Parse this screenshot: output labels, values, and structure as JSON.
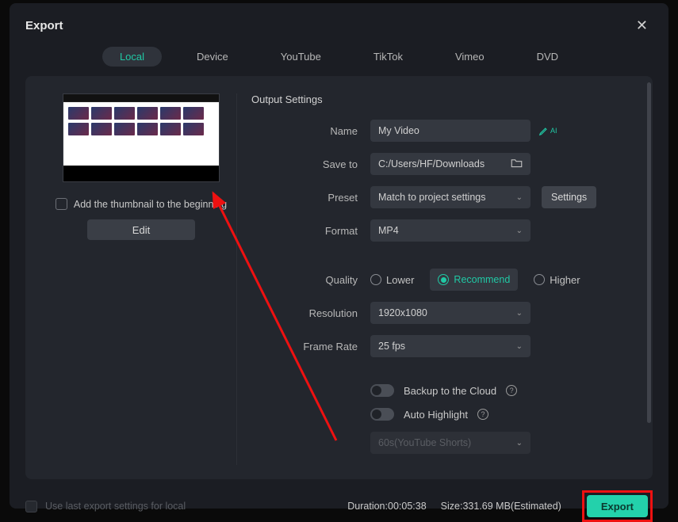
{
  "title": "Export",
  "tabs": {
    "local": "Local",
    "device": "Device",
    "youtube": "YouTube",
    "tiktok": "TikTok",
    "vimeo": "Vimeo",
    "dvd": "DVD"
  },
  "thumb_chk": "Add the thumbnail to the beginning",
  "edit": "Edit",
  "section": "Output Settings",
  "labels": {
    "name": "Name",
    "saveto": "Save to",
    "preset": "Preset",
    "format": "Format",
    "quality": "Quality",
    "resolution": "Resolution",
    "framerate": "Frame Rate"
  },
  "values": {
    "name": "My Video",
    "saveto": "C:/Users/HF/Downloads",
    "preset": "Match to project settings",
    "format": "MP4",
    "resolution": "1920x1080",
    "framerate": "25 fps",
    "highlight_preset": "60s(YouTube Shorts)"
  },
  "settings_btn": "Settings",
  "quality": {
    "lower": "Lower",
    "recommend": "Recommend",
    "higher": "Higher"
  },
  "toggles": {
    "backup": "Backup to the Cloud",
    "highlight": "Auto Highlight"
  },
  "footer": {
    "uselast": "Use last export settings for local",
    "duration_label": "Duration:",
    "duration": "00:05:38",
    "size_label": "Size:",
    "size": "331.69 MB(Estimated)",
    "export": "Export"
  },
  "ai_suffix": "AI"
}
